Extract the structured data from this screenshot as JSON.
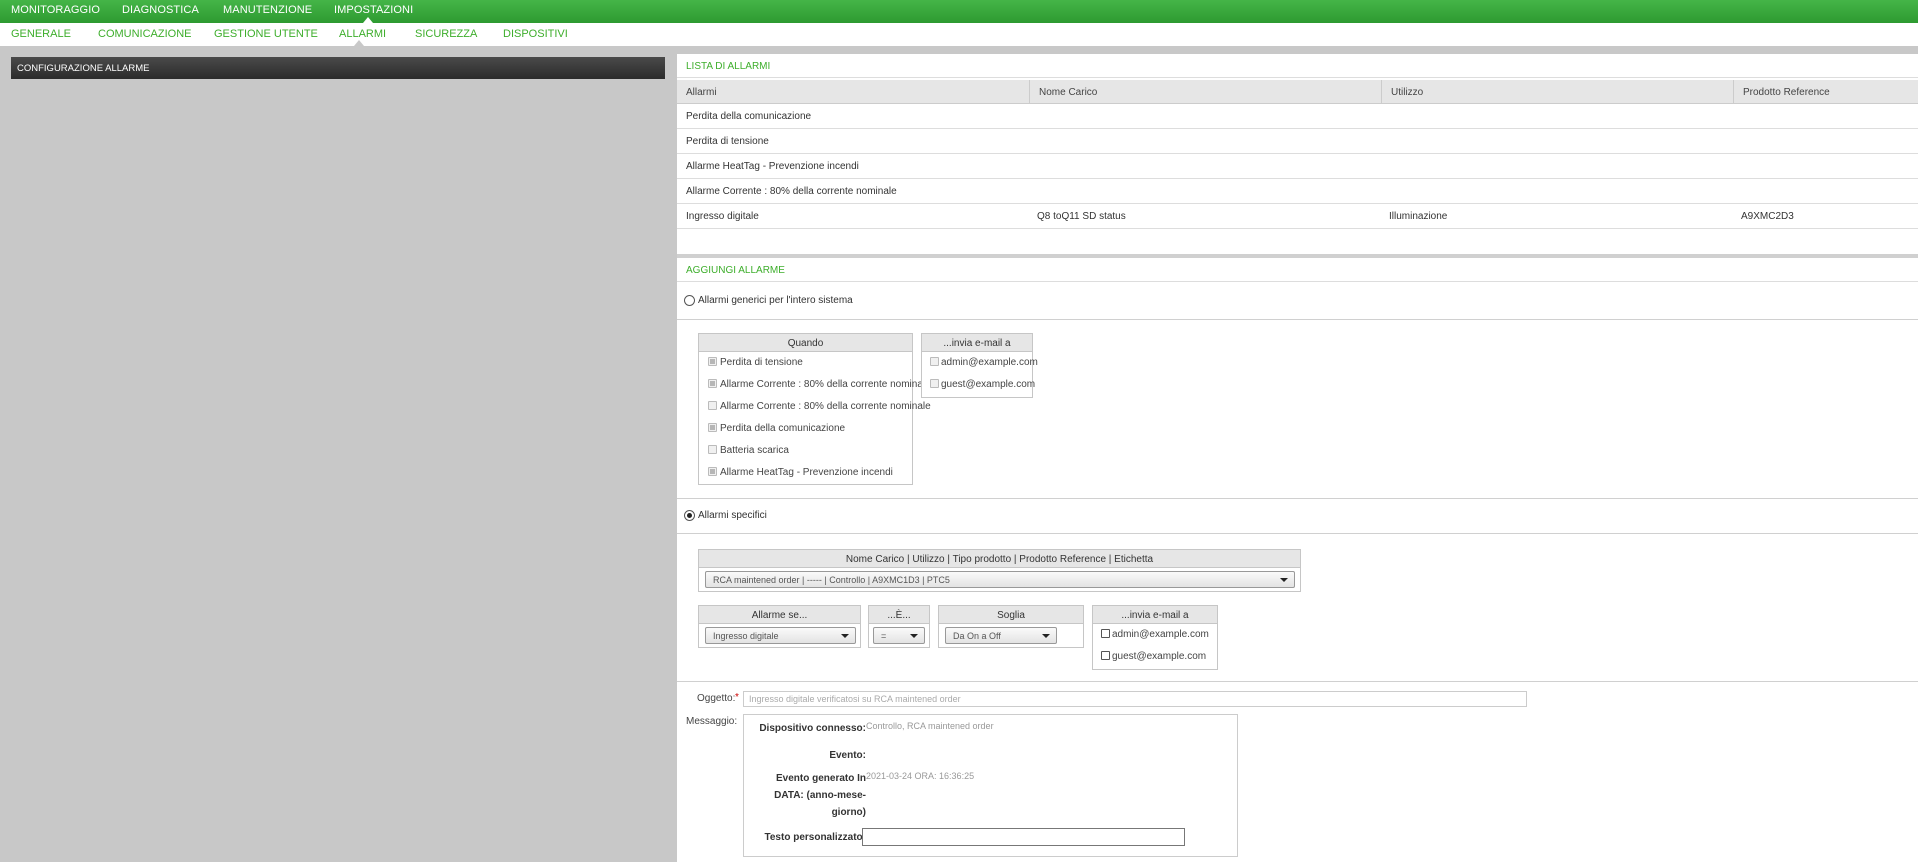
{
  "topnav": {
    "items": [
      {
        "label": "MONITORAGGIO"
      },
      {
        "label": "DIAGNOSTICA"
      },
      {
        "label": "MANUTENZIONE"
      },
      {
        "label": "IMPOSTAZIONI"
      }
    ]
  },
  "subnav": {
    "items": [
      {
        "label": "GENERALE"
      },
      {
        "label": "COMUNICAZIONE"
      },
      {
        "label": "GESTIONE UTENTE"
      },
      {
        "label": "ALLARMI"
      },
      {
        "label": "SICUREZZA"
      },
      {
        "label": "DISPOSITIVI"
      }
    ]
  },
  "left_panel": {
    "title": "CONFIGURAZIONE ALLARME"
  },
  "alarm_list": {
    "title": "LISTA DI ALLARMI",
    "columns": [
      "Allarmi",
      "Nome Carico",
      "Utilizzo",
      "Prodotto Reference"
    ],
    "rows": [
      [
        "Perdita della comunicazione",
        "",
        "",
        ""
      ],
      [
        "Perdita di tensione",
        "",
        "",
        ""
      ],
      [
        "Allarme HeatTag - Prevenzione incendi",
        "",
        "",
        ""
      ],
      [
        "Allarme Corrente : 80% della corrente nominale",
        "",
        "",
        ""
      ],
      [
        "Ingresso digitale",
        "Q8 toQ11 SD status",
        "Illuminazione",
        "A9XMC2D3"
      ]
    ]
  },
  "add_alarm": {
    "title": "AGGIUNGI ALLARME",
    "generic_label": "Allarmi generici per l'intero sistema",
    "generic_selected": false,
    "when_box": {
      "header": "Quando",
      "items": [
        {
          "label": "Perdita di tensione",
          "checked": true
        },
        {
          "label": "Allarme Corrente : 80% della corrente nominale",
          "checked": true
        },
        {
          "label": "Allarme Corrente : 80% della corrente nominale",
          "checked": false
        },
        {
          "label": "Perdita della comunicazione",
          "checked": true
        },
        {
          "label": "Batteria scarica",
          "checked": false
        },
        {
          "label": "Allarme HeatTag - Prevenzione incendi",
          "checked": true
        }
      ]
    },
    "email_box_generic": {
      "header": "...invia e-mail a",
      "items": [
        {
          "label": "admin@example.com",
          "checked": false
        },
        {
          "label": "guest@example.com",
          "checked": false
        }
      ]
    },
    "specific_label": "Allarmi specifici",
    "specific_selected": true,
    "load_box": {
      "header": "Nome Carico | Utilizzo | Tipo prodotto | Prodotto Reference | Etichetta",
      "selected": "RCA maintened order | ----- | Controllo | A9XMC1D3 | PTC5"
    },
    "alarm_if": {
      "header": "Allarme se...",
      "selected": "Ingresso digitale"
    },
    "is": {
      "header": "...È...",
      "selected": "="
    },
    "threshold": {
      "header": "Soglia",
      "selected": "Da On a Off"
    },
    "email_box_specific": {
      "header": "...invia e-mail a",
      "items": [
        {
          "label": "admin@example.com",
          "checked": false
        },
        {
          "label": "guest@example.com",
          "checked": false
        }
      ]
    }
  },
  "mail": {
    "subject_label": "Oggetto:",
    "required_mark": "*",
    "subject_value": "Ingresso digitale    verificatosi su RCA maintened order",
    "message_label": "Messaggio:",
    "device_label": "Dispositivo connesso:",
    "device_value": "Controllo, RCA maintened order",
    "event_label": "Evento:",
    "event_value": "",
    "date_label": "Evento generato In DATA: (anno-mese-giorno)",
    "date_value": "2021-03-24 ORA: 16:36:25",
    "custom_label": "Testo personalizzato:",
    "custom_value": ""
  }
}
